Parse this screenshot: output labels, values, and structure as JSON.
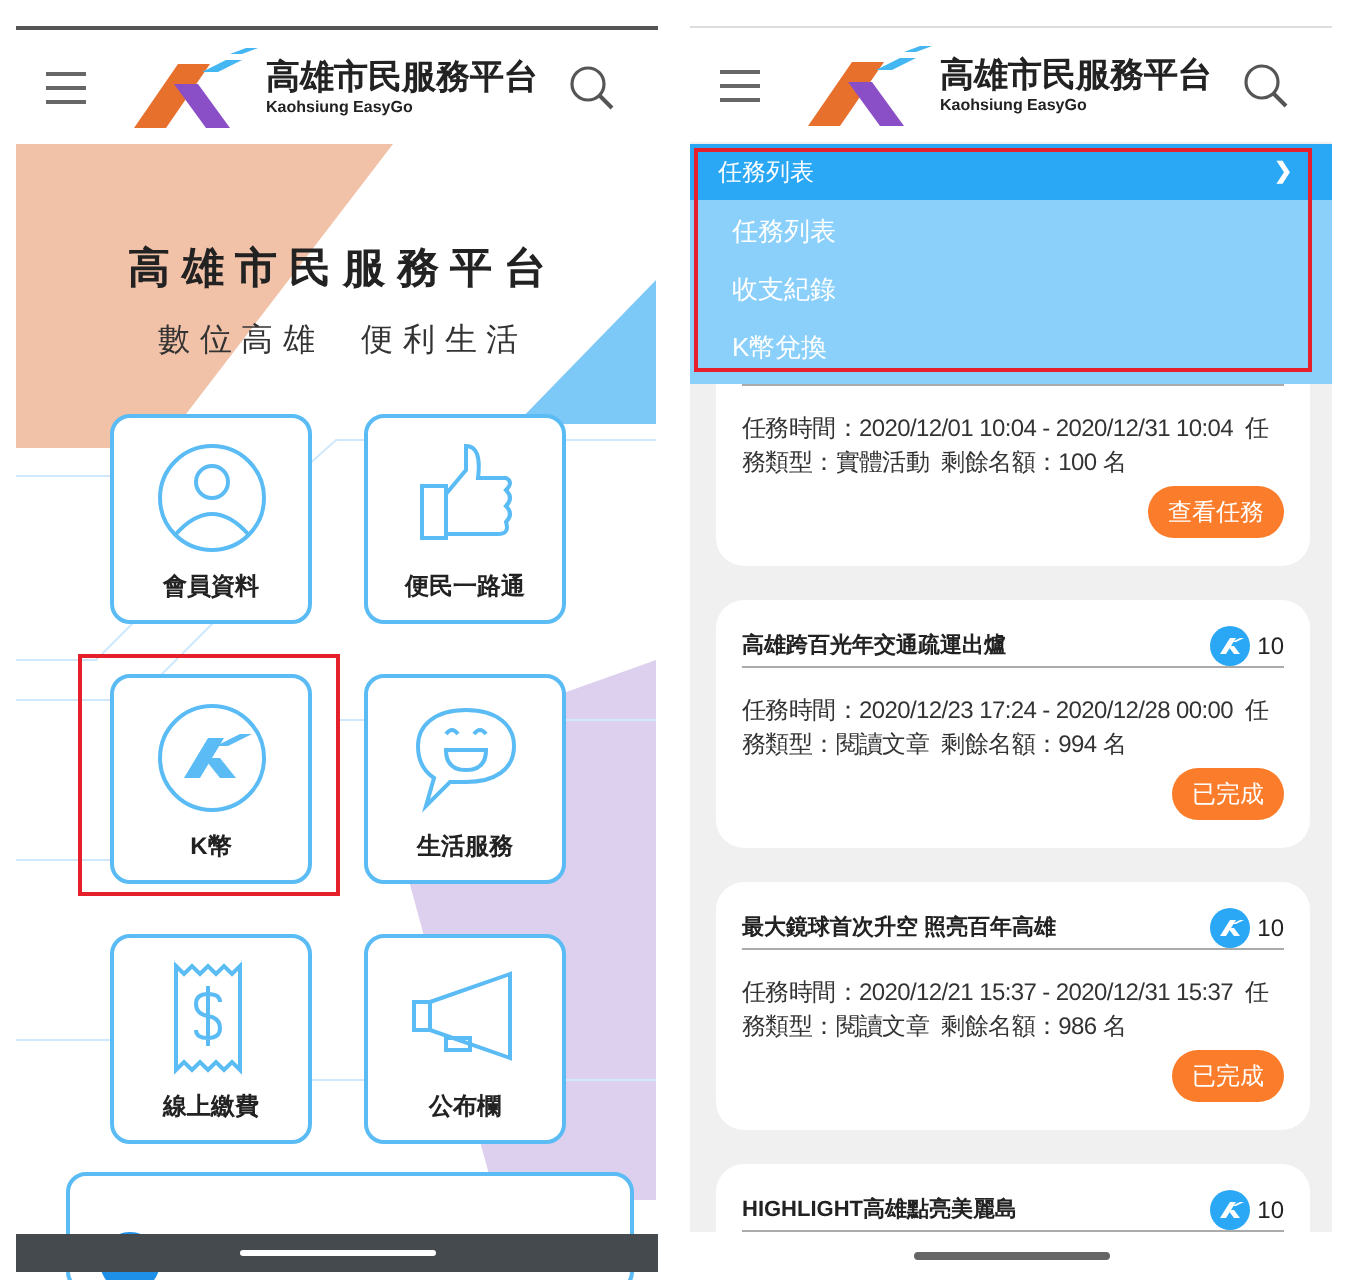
{
  "left_screen": {
    "header": {
      "logo_title": "高雄市民服務平台",
      "logo_subtitle": "Kaohsiung EasyGo"
    },
    "hero": {
      "title": "高雄市民服務平台",
      "subtitle": "數位高雄 便利生活"
    },
    "tiles": [
      {
        "label": "會員資料",
        "kind": "person",
        "highlighted": false
      },
      {
        "label": "便民一路通",
        "kind": "thumb",
        "highlighted": false
      },
      {
        "label": "K幣",
        "kind": "coin",
        "highlighted": true
      },
      {
        "label": "生活服務",
        "kind": "chat",
        "highlighted": false
      },
      {
        "label": "線上繳費",
        "kind": "receipt",
        "highlighted": false
      },
      {
        "label": "公布欄",
        "kind": "megaphone",
        "highlighted": false
      }
    ]
  },
  "right_screen": {
    "header": {
      "logo_title": "高雄市民服務平台",
      "logo_subtitle": "Kaohsiung EasyGo"
    },
    "dropdown": {
      "header": "任務列表",
      "chevron": "❯",
      "highlighted": true,
      "items": [
        "任務列表",
        "收支紀錄",
        "K幣兌換"
      ]
    },
    "tasks": [
      {
        "info": "任務時間：2020/12/01 10:04 - 2020/12/31 10:04  任務類型：實體活動  剩餘名額：100 名",
        "button": "查看任務"
      },
      {
        "title": "高雄跨百光年交通疏運出爐",
        "points": "10",
        "info": "任務時間：2020/12/23 17:24 - 2020/12/28 00:00  任務類型：閱讀文章  剩餘名額：994 名",
        "button": "已完成"
      },
      {
        "title": "最大鏡球首次升空 照亮百年高雄",
        "points": "10",
        "info": "任務時間：2020/12/21 15:37 - 2020/12/31 15:37  任務類型：閱讀文章  剩餘名額：986 名",
        "button": "已完成"
      },
      {
        "title": "HIGHLIGHT高雄點亮美麗島",
        "points": "10"
      }
    ]
  }
}
